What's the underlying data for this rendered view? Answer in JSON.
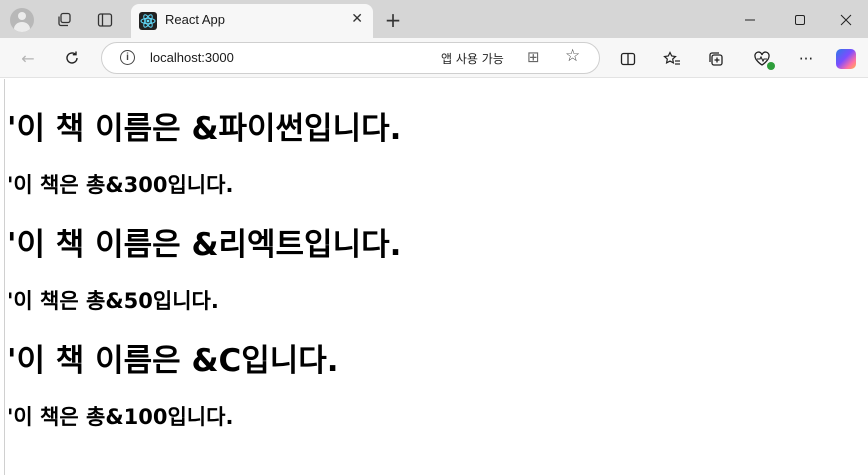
{
  "tab": {
    "title": "React App"
  },
  "address": {
    "url": "localhost:3000",
    "app_available": "앱 사용 가능"
  },
  "books": [
    {
      "title_line": "'이 책 이름은 &파이썬입니다.",
      "pages_line": "'이 책은 총&300입니다."
    },
    {
      "title_line": "'이 책 이름은 &리엑트입니다.",
      "pages_line": "'이 책은 총&50입니다."
    },
    {
      "title_line": "'이 책 이름은 &C입니다.",
      "pages_line": "'이 책은 총&100입니다."
    }
  ],
  "colors": {
    "titlebar": "#d6d6d6",
    "toolbar": "#f7f7f7",
    "text": "#000000"
  }
}
